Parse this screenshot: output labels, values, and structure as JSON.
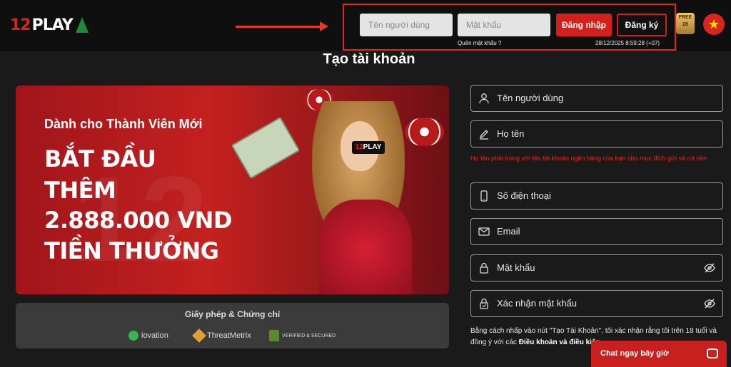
{
  "header": {
    "logo_num": "12",
    "logo_text": "PLAY",
    "username_placeholder": "Tên người dùng",
    "password_placeholder": "Mật khẩu",
    "login_label": "Đăng nhập",
    "register_label": "Đăng ký",
    "forgot_label": "Quên mật khẩu ?",
    "datetime": "28/12/2025 8:59:28 (+07)",
    "free_badge_top": "FREE",
    "free_badge_bottom": "28"
  },
  "page": {
    "title": "Tạo tài khoản"
  },
  "banner": {
    "subtitle": "Dành cho Thành Viên Mới",
    "line1": "BẮT ĐẦU",
    "line2": "THÊM",
    "line3": "2.888.000 VND",
    "line4": "TIỀN THƯỞNG",
    "brand_num": "12",
    "brand_text": "PLAY"
  },
  "license": {
    "title": "Giấy phép & Chứng chỉ",
    "logos": [
      "iovation",
      "ThreatMetrix",
      "VERIFIED & SECURED"
    ]
  },
  "form": {
    "username": "Tên người dùng",
    "fullname": "Họ tên",
    "fullname_note": "Họ tên phải trùng với tên tài khoản ngân hàng của bạn cho mục đích gửi và rút tiền",
    "phone": "Số điện thoại",
    "email": "Email",
    "password": "Mật khẩu",
    "confirm_password": "Xác nhận mật khẩu",
    "terms_text": "Bằng cách nhấp vào nút \"Tạo Tài Khoản\", tôi xác nhận rằng tôi trên 18 tuổi và đồng ý với các",
    "terms_link": "Điều khoản và điều kiện"
  },
  "chat": {
    "label": "Chat ngay bây giờ"
  },
  "colors": {
    "accent": "#d3201d",
    "background": "#1a1a1a",
    "topbar": "#0f0f0f"
  }
}
